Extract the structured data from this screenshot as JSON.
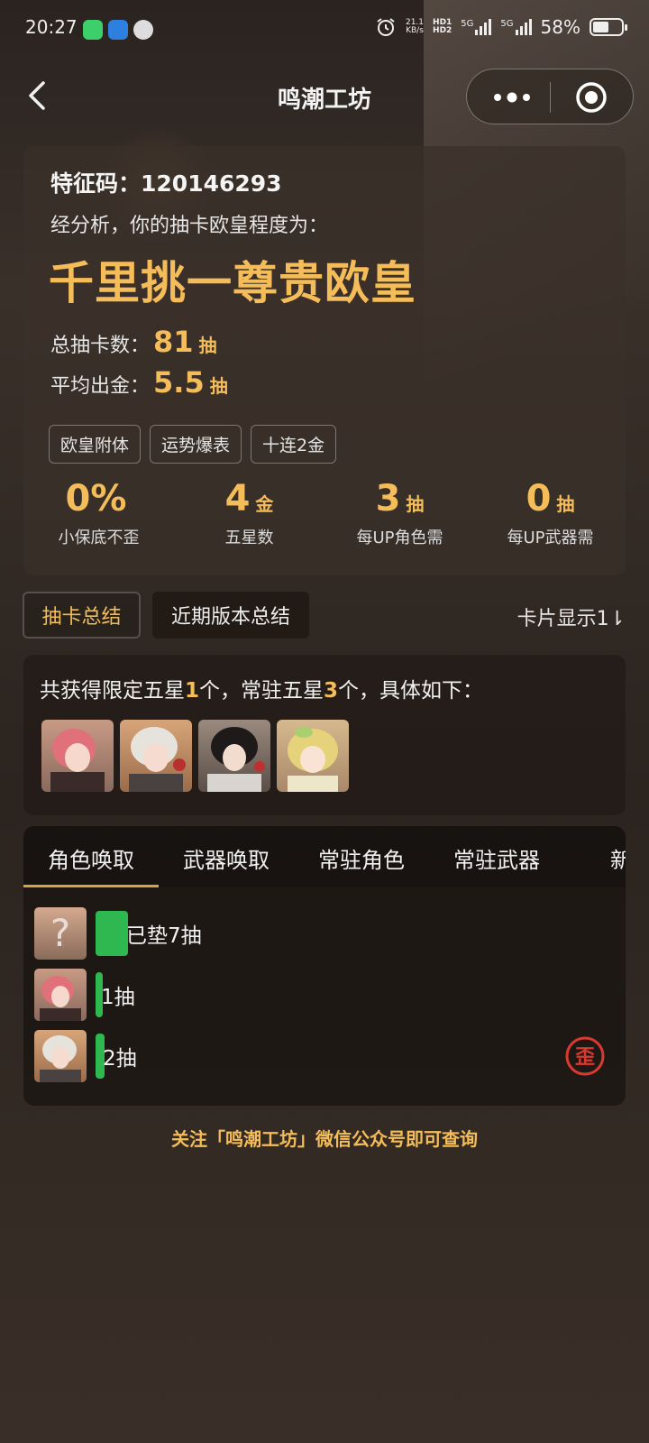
{
  "status_bar": {
    "time": "20:27",
    "net_speed_value": "21.1",
    "net_speed_unit": "KB/s",
    "hd1": "HD1",
    "hd2": "HD2",
    "sig1_label": "5G",
    "sig2_label": "5G",
    "battery": "58%",
    "icons": [
      "chat-app-icon",
      "map-app-icon",
      "browser-app-icon",
      "alarm-icon",
      "signal-icon",
      "battery-icon"
    ]
  },
  "nav": {
    "title": "鸣潮工坊",
    "icons": [
      "back-arrow-icon",
      "more-dots-icon",
      "target-icon"
    ]
  },
  "profile": {
    "code_label": "特征码：",
    "code_value": "120146293",
    "analysis_text": "经分析，你的抽卡欧皇程度为：",
    "rank_title": "千里挑一尊贵欧皇",
    "total_label": "总抽卡数：",
    "total_value": "81",
    "total_unit": "抽",
    "avg_label": "平均出金：",
    "avg_value": "5.5",
    "avg_unit": "抽",
    "tags": [
      "欧皇附体",
      "运势爆表",
      "十连2金"
    ]
  },
  "metrics": [
    {
      "value": "0%",
      "unit": "",
      "label": "小保底不歪"
    },
    {
      "value": "4",
      "unit": "金",
      "label": "五星数"
    },
    {
      "value": "3",
      "unit": "抽",
      "label": "每UP角色需"
    },
    {
      "value": "0",
      "unit": "抽",
      "label": "每UP武器需"
    }
  ],
  "summary_tabs": {
    "active": "抽卡总结",
    "other": "近期版本总结",
    "display_toggle": "卡片显示1⇂"
  },
  "summary": {
    "prefix": "共获得限定五星",
    "limited_count": "1",
    "middle": "个，常驻五星",
    "standard_count": "3",
    "suffix": "个，具体如下："
  },
  "banner_tabs": [
    "角色唤取",
    "武器唤取",
    "常驻角色",
    "常驻武器",
    "新手"
  ],
  "pulls": [
    {
      "label": "已垫7抽",
      "pulls": 7
    },
    {
      "label": "1抽",
      "pulls": 1
    },
    {
      "label": "2抽",
      "pulls": 2
    }
  ],
  "lose_badge_char": "歪",
  "footer": "关注「鸣潮工坊」微信公众号即可查询",
  "colors": {
    "accent_gold": "#f4bd59",
    "bar_green": "#2fb84f",
    "lose_red": "#d93a2f"
  }
}
